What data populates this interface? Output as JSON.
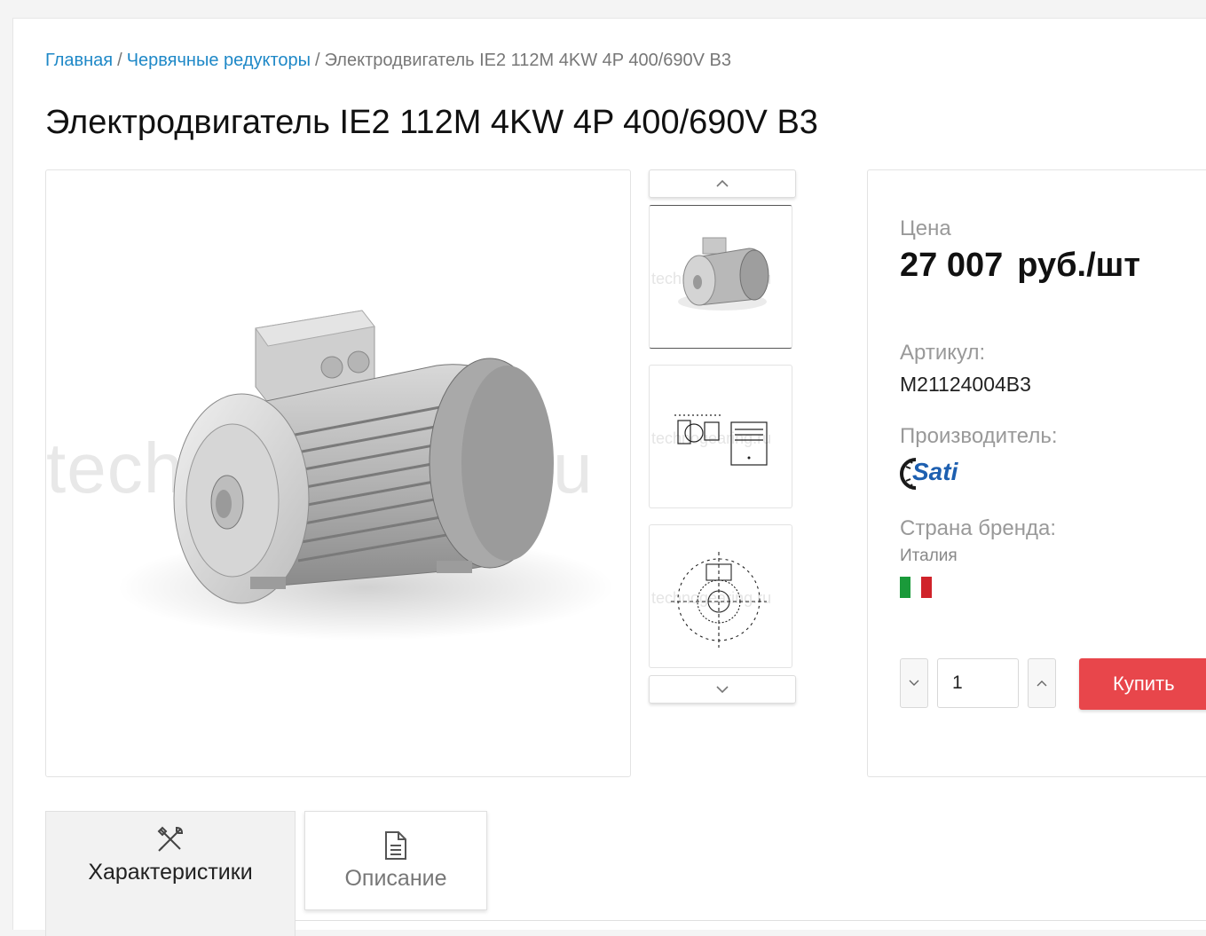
{
  "breadcrumb": {
    "home": "Главная",
    "category": "Червячные редукторы",
    "current": "Электродвигатель IE2 112M 4KW 4P 400/690V B3",
    "separator": "/"
  },
  "product": {
    "title": "Электродвигатель IE2 112M 4KW 4P 400/690V B3",
    "watermark": "technogearing.ru",
    "thumb_watermark": "technogearing.ru"
  },
  "info": {
    "price_label": "Цена",
    "price_value": "27 007",
    "price_unit": "руб./шт",
    "sku_label": "Артикул:",
    "sku_value": "M21124004B3",
    "manufacturer_label": "Производитель:",
    "brand_logo_text": "Sati",
    "country_label": "Страна бренда:",
    "country_value": "Италия",
    "flag_colors": [
      "#1a9a3a",
      "#ffffff",
      "#d0232a"
    ]
  },
  "purchase": {
    "quantity": "1",
    "buy_label": "Купить",
    "accent_color": "#e8464b"
  },
  "tabs": [
    {
      "label": "Характеристики",
      "icon": "tools-icon",
      "active": true
    },
    {
      "label": "Описание",
      "icon": "document-icon",
      "active": false
    }
  ],
  "colors": {
    "link": "#1e88c7"
  }
}
